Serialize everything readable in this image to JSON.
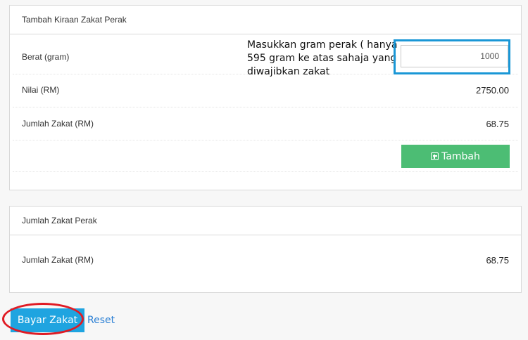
{
  "kiraan_panel": {
    "title": "Tambah Kiraan Zakat Perak",
    "berat": {
      "label": "Berat (gram)",
      "value": "1000"
    },
    "nilai": {
      "label": "Nilai (RM)",
      "value": "2750.00"
    },
    "jumlah": {
      "label": "Jumlah Zakat (RM)",
      "value": "68.75"
    },
    "tambah_label": "Tambah",
    "tambah_icon": "plus-square-icon"
  },
  "annotation": {
    "text": "Masukkan gram perak ( hanya 595 gram ke atas sahaja yang diwajibkan zakat",
    "highlight_color": "#1a97d6"
  },
  "total_panel": {
    "title": "Jumlah Zakat Perak",
    "jumlah": {
      "label": "Jumlah Zakat (RM)",
      "value": "68.75"
    }
  },
  "actions": {
    "bayar_label": "Bayar Zakat",
    "reset_label": "Reset",
    "highlight_color": "#e01b24"
  },
  "colors": {
    "success": "#4cbd74",
    "primary": "#1fa4e0",
    "link": "#2a7fd4"
  }
}
